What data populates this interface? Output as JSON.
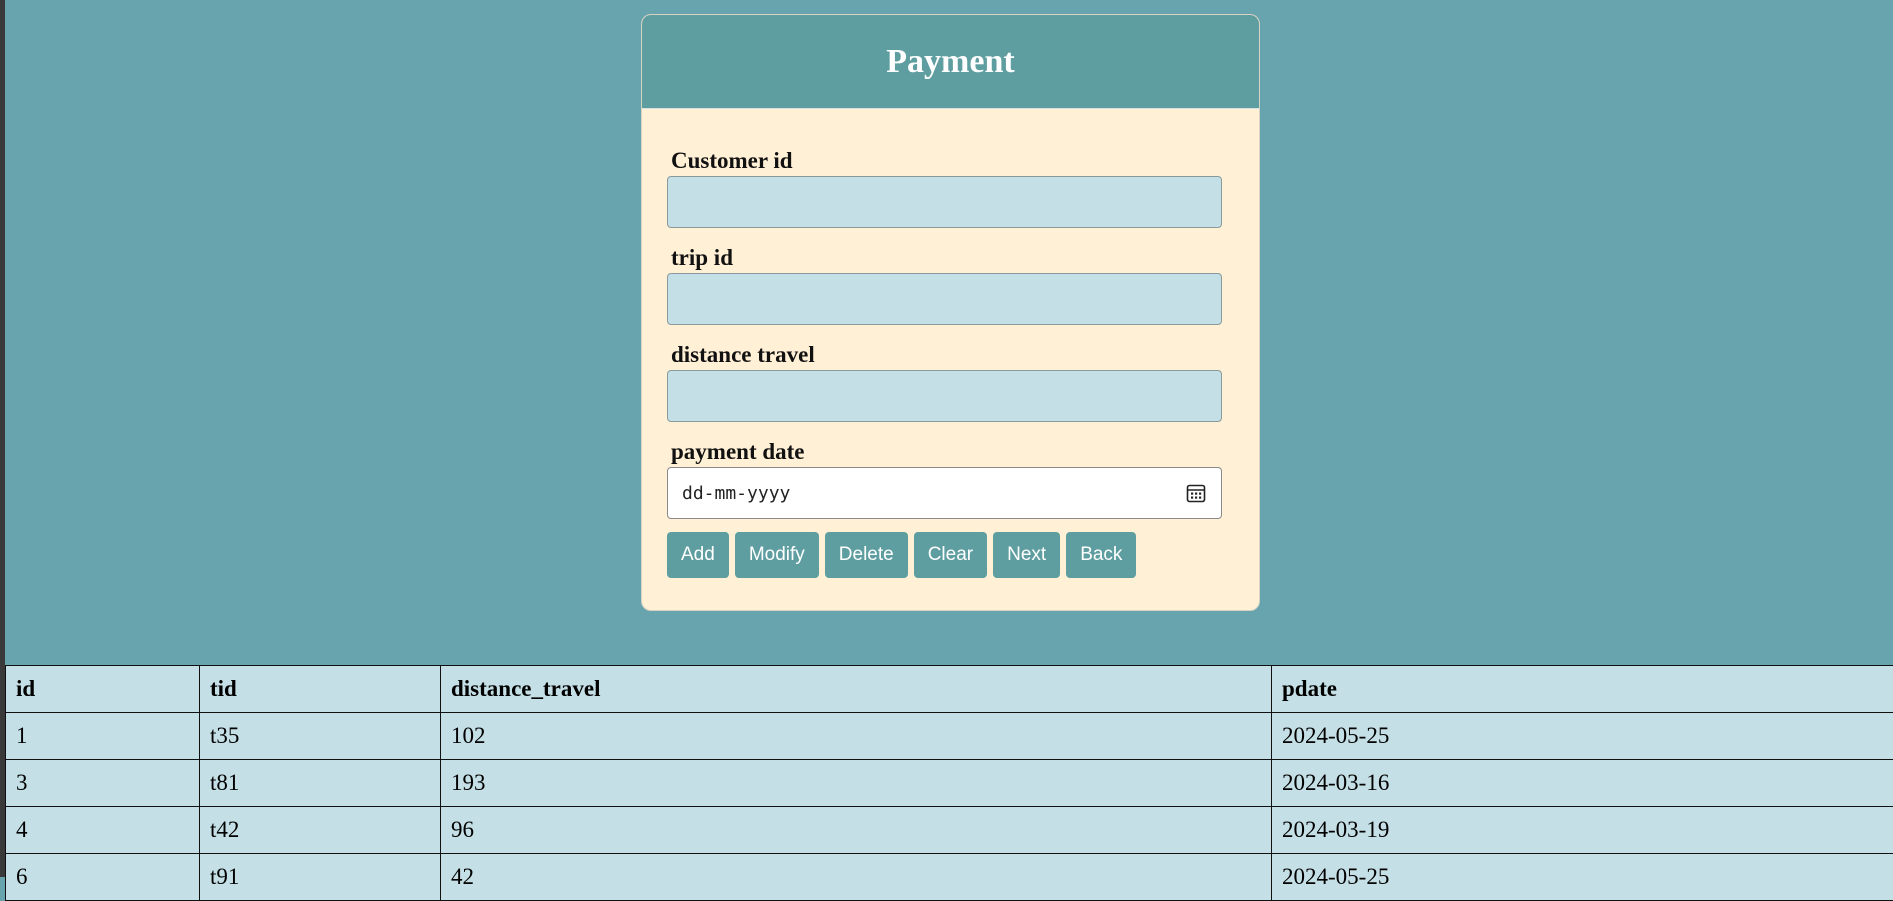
{
  "form": {
    "title": "Payment",
    "fields": [
      {
        "label": "Customer id",
        "value": ""
      },
      {
        "label": "trip id",
        "value": ""
      },
      {
        "label": "distance travel",
        "value": ""
      },
      {
        "label": "payment date",
        "placeholder": "dd-mm-yyyy"
      }
    ],
    "buttons": [
      "Add",
      "Modify",
      "Delete",
      "Clear",
      "Next",
      "Back"
    ]
  },
  "table": {
    "headers": [
      "id",
      "tid",
      "distance_travel",
      "pdate"
    ],
    "rows": [
      [
        "1",
        "t35",
        "102",
        "2024-05-25"
      ],
      [
        "3",
        "t81",
        "193",
        "2024-03-16"
      ],
      [
        "4",
        "t42",
        "96",
        "2024-03-19"
      ],
      [
        "6",
        "t91",
        "42",
        "2024-05-25"
      ]
    ]
  },
  "icons": {
    "date_picker": "calendar-icon"
  },
  "colors": {
    "page_background": "#67a4ae",
    "header_accent": "#5f9ea0",
    "card_background": "#fff0d6",
    "input_background": "#c4dfe5",
    "table_background": "#c4dfe5"
  }
}
